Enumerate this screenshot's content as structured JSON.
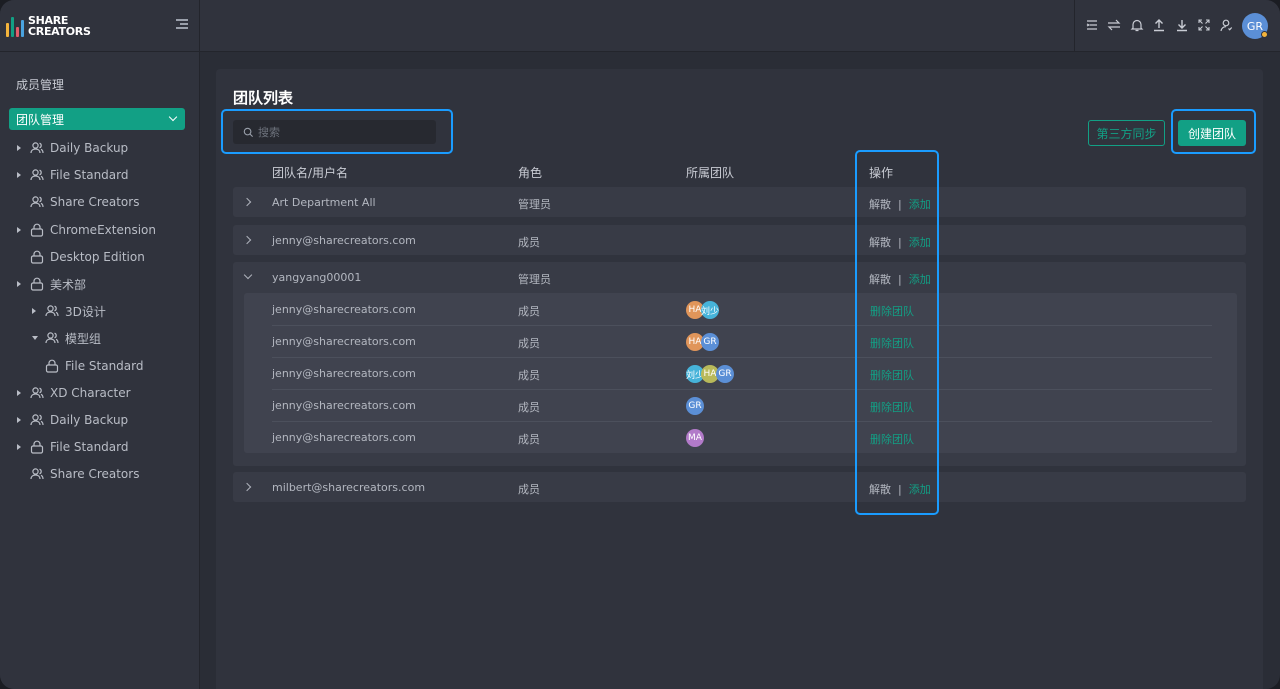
{
  "brand": {
    "line1": "SHARE",
    "line2": "CREATORS"
  },
  "colors": {
    "accent": "#12a085",
    "highlight": "#1a9cff",
    "avatar_gr": "#5b8fd6",
    "avatar_ha": "#e0955a",
    "avatar_liu": "#46b3d9",
    "avatar_ma": "#b27ac9",
    "avatar_ha2": "#b8b95a"
  },
  "sidebar": {
    "section_title": "成员管理",
    "active_item": "团队管理",
    "items": [
      {
        "label": "Daily Backup",
        "icon": "users-icon"
      },
      {
        "label": "File Standard",
        "icon": "users-icon"
      },
      {
        "label": "Share Creators",
        "icon": "users-icon"
      },
      {
        "label": "ChromeExtension",
        "icon": "lock-icon"
      },
      {
        "label": "Desktop Edition",
        "icon": "lock-icon"
      },
      {
        "label": "美术部",
        "icon": "lock-icon"
      },
      {
        "label": "3D设计",
        "icon": "users-icon"
      },
      {
        "label": "模型组",
        "icon": "users-icon"
      },
      {
        "label": "File Standard",
        "icon": "lock-icon"
      },
      {
        "label": "XD Character",
        "icon": "users-icon"
      },
      {
        "label": "Daily Backup",
        "icon": "users-icon"
      },
      {
        "label": "File Standard",
        "icon": "lock-icon"
      },
      {
        "label": "Share Creators",
        "icon": "users-icon"
      }
    ]
  },
  "topbar": {
    "icons": [
      "list-icon",
      "swap-icon",
      "bell-icon",
      "upload-icon",
      "download-icon",
      "fullscreen-icon",
      "user-icon"
    ],
    "avatar": "GR"
  },
  "main": {
    "title": "团队列表",
    "search_placeholder": "搜索",
    "sync_button": "第三方同步",
    "create_button": "创建团队",
    "columns": [
      "团队名/用户名",
      "角色",
      "所属团队",
      "操作"
    ],
    "rows": [
      {
        "name": "Art Department All",
        "role": "管理员",
        "action1": "解散",
        "action2": "添加"
      },
      {
        "name": "jenny@sharecreators.com",
        "role": "成员",
        "action1": "解散",
        "action2": "添加"
      },
      {
        "name": "yangyang00001",
        "role": "管理员",
        "action1": "解散",
        "action2": "添加"
      },
      {
        "name": "milbert@sharecreators.com",
        "role": "成员",
        "action1": "解散",
        "action2": "添加"
      }
    ],
    "members": [
      {
        "name": "jenny@sharecreators.com",
        "role": "成员",
        "teams": [
          "HA",
          "刘少"
        ],
        "action": "删除团队"
      },
      {
        "name": "jenny@sharecreators.com",
        "role": "成员",
        "teams": [
          "HA",
          "GR"
        ],
        "action": "删除团队"
      },
      {
        "name": "jenny@sharecreators.com",
        "role": "成员",
        "teams": [
          "刘少",
          "HA",
          "GR"
        ],
        "action": "删除团队"
      },
      {
        "name": "jenny@sharecreators.com",
        "role": "成员",
        "teams": [
          "GR"
        ],
        "action": "删除团队"
      },
      {
        "name": "jenny@sharecreators.com",
        "role": "成员",
        "teams": [
          "MA"
        ],
        "action": "删除团队"
      }
    ]
  }
}
